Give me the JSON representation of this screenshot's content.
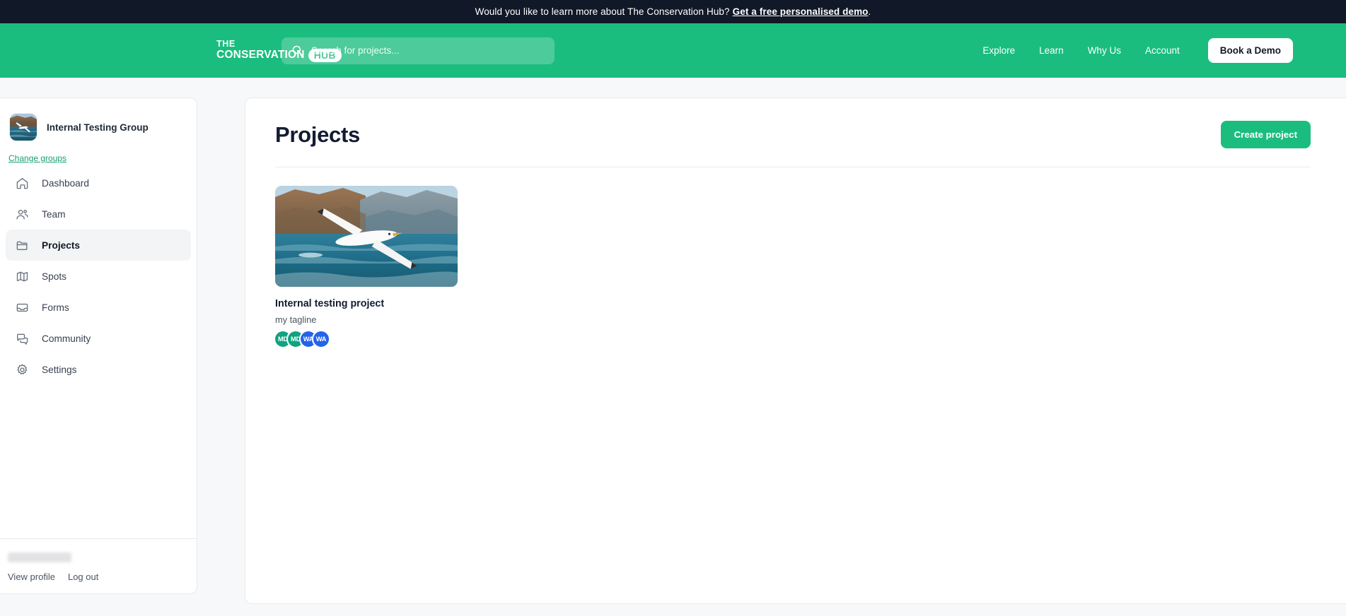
{
  "banner": {
    "text": "Would you like to learn more about The Conservation Hub?",
    "link_label": "Get a free personalised demo",
    "period": "."
  },
  "navbar": {
    "logo": {
      "line1": "THE",
      "line2": "CONSERVATION",
      "pill": "HUB"
    },
    "search": {
      "placeholder": "Search for projects...",
      "value": "",
      "icon": "search-icon"
    },
    "links": [
      {
        "label": "Explore"
      },
      {
        "label": "Learn"
      },
      {
        "label": "Why Us"
      },
      {
        "label": "Account"
      }
    ],
    "cta_label": "Book a Demo",
    "background_color": "#1bbd7e"
  },
  "sidebar": {
    "group": {
      "name": "Internal Testing Group",
      "change_link": "Change groups",
      "avatar_alt": "group-photo-gannet-over-ocean"
    },
    "items": [
      {
        "label": "Dashboard",
        "icon": "home-icon",
        "active": false
      },
      {
        "label": "Team",
        "icon": "users-icon",
        "active": false
      },
      {
        "label": "Projects",
        "icon": "folder-icon",
        "active": true
      },
      {
        "label": "Spots",
        "icon": "map-icon",
        "active": false
      },
      {
        "label": "Forms",
        "icon": "inbox-icon",
        "active": false
      },
      {
        "label": "Community",
        "icon": "chat-icon",
        "active": false
      },
      {
        "label": "Settings",
        "icon": "gear-icon",
        "active": false
      }
    ],
    "footer": {
      "username_redacted": "",
      "view_profile_label": "View profile",
      "logout_label": "Log out"
    }
  },
  "main": {
    "title": "Projects",
    "create_button_label": "Create project",
    "projects": [
      {
        "name": "Internal testing project",
        "tagline": "my tagline",
        "thumb_alt": "project-photo-gannet-flying-over-sea-cliffs",
        "members": [
          {
            "initials": "MD",
            "color": "#10a37f"
          },
          {
            "initials": "MD",
            "color": "#10a37f"
          },
          {
            "initials": "WA",
            "color": "#2563eb"
          },
          {
            "initials": "WA",
            "color": "#2563eb"
          }
        ]
      }
    ]
  },
  "theme": {
    "accent_green": "#1bbd7e",
    "banner_dark": "#111827",
    "page_bg": "#f7f8f9",
    "link_green": "#16a070"
  }
}
